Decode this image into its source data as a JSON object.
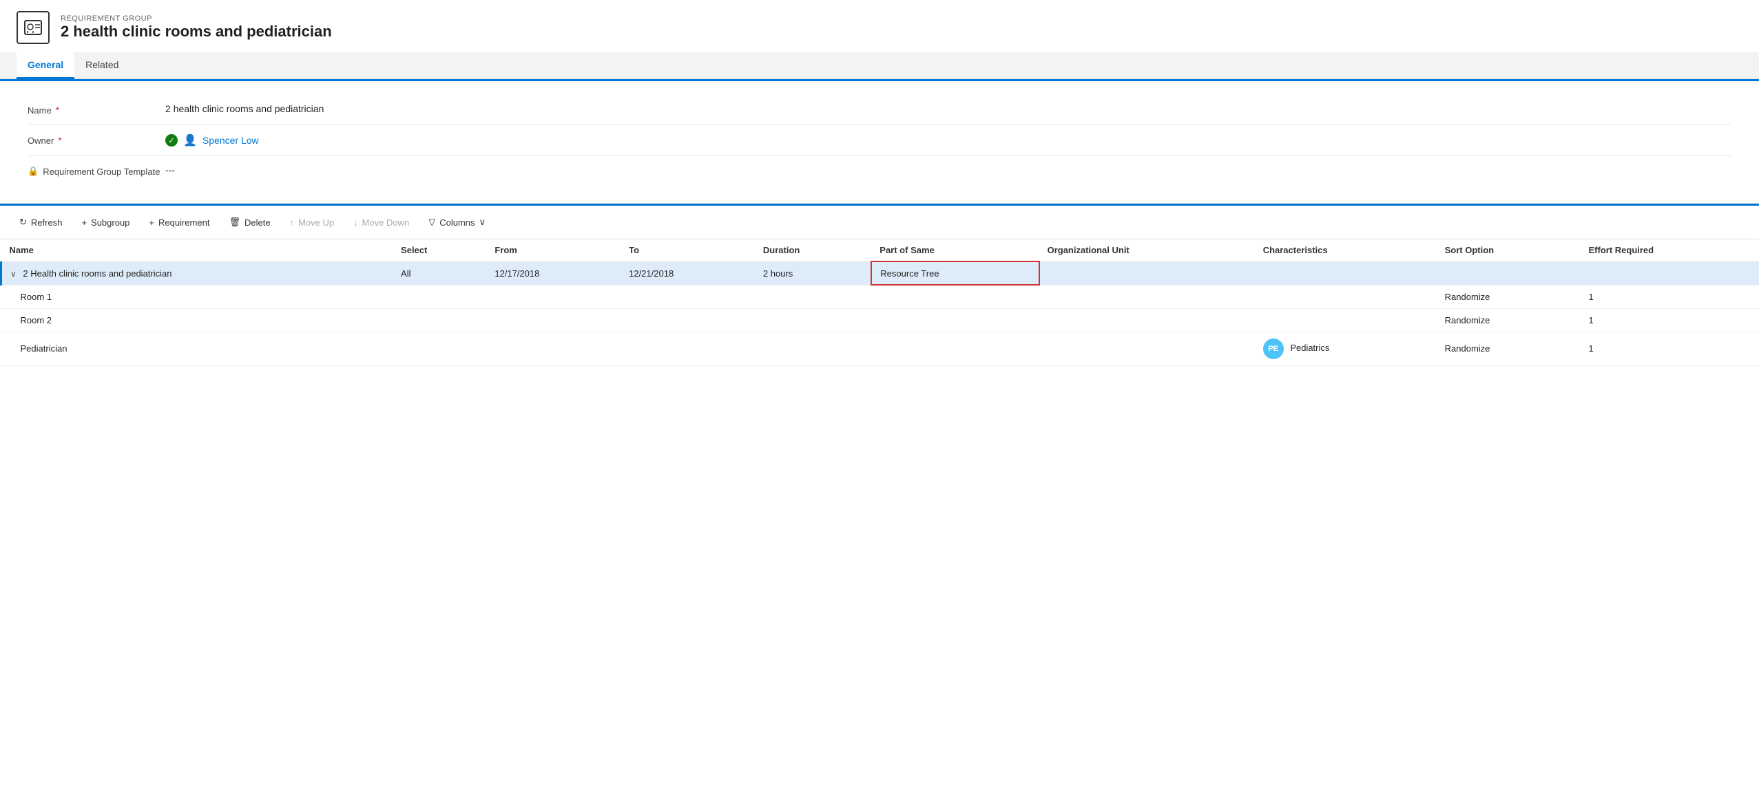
{
  "header": {
    "entity_type": "REQUIREMENT GROUP",
    "title": "2 health clinic rooms and pediatrician"
  },
  "tabs": [
    {
      "id": "general",
      "label": "General",
      "active": true
    },
    {
      "id": "related",
      "label": "Related",
      "active": false
    }
  ],
  "form": {
    "fields": [
      {
        "id": "name",
        "label": "Name",
        "required": true,
        "value": "2 health clinic rooms and pediatrician",
        "type": "text"
      },
      {
        "id": "owner",
        "label": "Owner",
        "required": true,
        "value": "Spencer Low",
        "type": "person",
        "has_check": true
      },
      {
        "id": "template",
        "label": "Requirement Group Template",
        "required": false,
        "value": "---",
        "type": "text",
        "has_lock": true
      }
    ]
  },
  "toolbar": {
    "refresh_label": "Refresh",
    "subgroup_label": "Subgroup",
    "requirement_label": "Requirement",
    "delete_label": "Delete",
    "move_up_label": "Move Up",
    "move_down_label": "Move Down",
    "columns_label": "Columns"
  },
  "table": {
    "columns": [
      {
        "id": "name",
        "label": "Name"
      },
      {
        "id": "select",
        "label": "Select"
      },
      {
        "id": "from",
        "label": "From"
      },
      {
        "id": "to",
        "label": "To"
      },
      {
        "id": "duration",
        "label": "Duration"
      },
      {
        "id": "part_of_same",
        "label": "Part of Same",
        "highlighted": true
      },
      {
        "id": "org_unit",
        "label": "Organizational Unit"
      },
      {
        "id": "characteristics",
        "label": "Characteristics"
      },
      {
        "id": "sort_option",
        "label": "Sort Option"
      },
      {
        "id": "effort_required",
        "label": "Effort Required"
      }
    ],
    "rows": [
      {
        "id": "group",
        "name": "2 Health clinic rooms and pediatrician",
        "indent": 0,
        "expandable": true,
        "select": "All",
        "from": "12/17/2018",
        "to": "12/21/2018",
        "duration": "2 hours",
        "part_of_same": "Resource Tree",
        "org_unit": "",
        "characteristics": "",
        "sort_option": "",
        "effort_required": "",
        "selected": true
      },
      {
        "id": "room1",
        "name": "Room 1",
        "indent": 1,
        "select": "",
        "from": "",
        "to": "",
        "duration": "",
        "part_of_same": "",
        "org_unit": "",
        "characteristics": "",
        "sort_option": "Randomize",
        "effort_required": "1"
      },
      {
        "id": "room2",
        "name": "Room 2",
        "indent": 1,
        "select": "",
        "from": "",
        "to": "",
        "duration": "",
        "part_of_same": "",
        "org_unit": "",
        "characteristics": "",
        "sort_option": "Randomize",
        "effort_required": "1"
      },
      {
        "id": "pediatrician",
        "name": "Pediatrician",
        "indent": 1,
        "select": "",
        "from": "",
        "to": "",
        "duration": "",
        "part_of_same": "",
        "org_unit": "",
        "characteristics": "Pediatrics",
        "characteristics_badge": "PE",
        "sort_option": "Randomize",
        "effort_required": "1"
      }
    ]
  }
}
